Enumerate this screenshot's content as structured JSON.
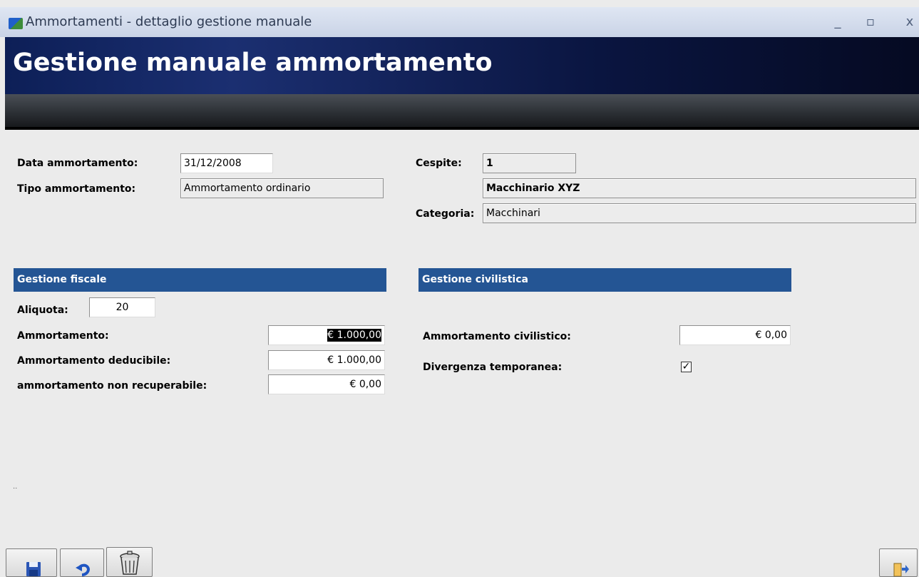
{
  "window": {
    "title": "Ammortamenti - dettaglio gestione manuale",
    "minimize_glyph": "_",
    "maximize_glyph": "▫",
    "close_glyph": "x"
  },
  "header": {
    "title": "Gestione manuale ammortamento"
  },
  "form": {
    "data_ammortamento": {
      "label": "Data ammortamento:",
      "value": "31/12/2008"
    },
    "tipo_ammortamento": {
      "label": "Tipo ammortamento:",
      "value": "Ammortamento ordinario"
    },
    "cespite": {
      "label": "Cespite:",
      "code": "1",
      "description": "Macchinario XYZ"
    },
    "categoria": {
      "label": "Categoria:",
      "value": "Macchinari"
    }
  },
  "fiscale": {
    "title": "Gestione fiscale",
    "aliquota": {
      "label": "Aliquota:",
      "value": "20"
    },
    "ammortamento": {
      "label": "Ammortamento:",
      "value": "€ 1.000,00"
    },
    "deducibile": {
      "label": "Ammortamento deducibile:",
      "value": "€ 1.000,00"
    },
    "non_recuperabile": {
      "label": "ammortamento non recuperabile:",
      "value": "€ 0,00"
    }
  },
  "civilistica": {
    "title": "Gestione civilistica",
    "ammortamento_civilistico": {
      "label": "Ammortamento civilistico:",
      "value": "€ 0,00"
    },
    "divergenza": {
      "label": "Divergenza temporanea:",
      "checked": true,
      "glyph": "✓"
    }
  },
  "footer": {
    "dots": "··"
  },
  "icons": {
    "save": "floppy-disk-icon",
    "undo": "undo-arrow-icon",
    "delete": "trash-can-icon",
    "exit": "exit-door-icon"
  },
  "colors": {
    "section_bar": "#245594",
    "banner": "#0d1f57",
    "background": "#ebebeb"
  }
}
